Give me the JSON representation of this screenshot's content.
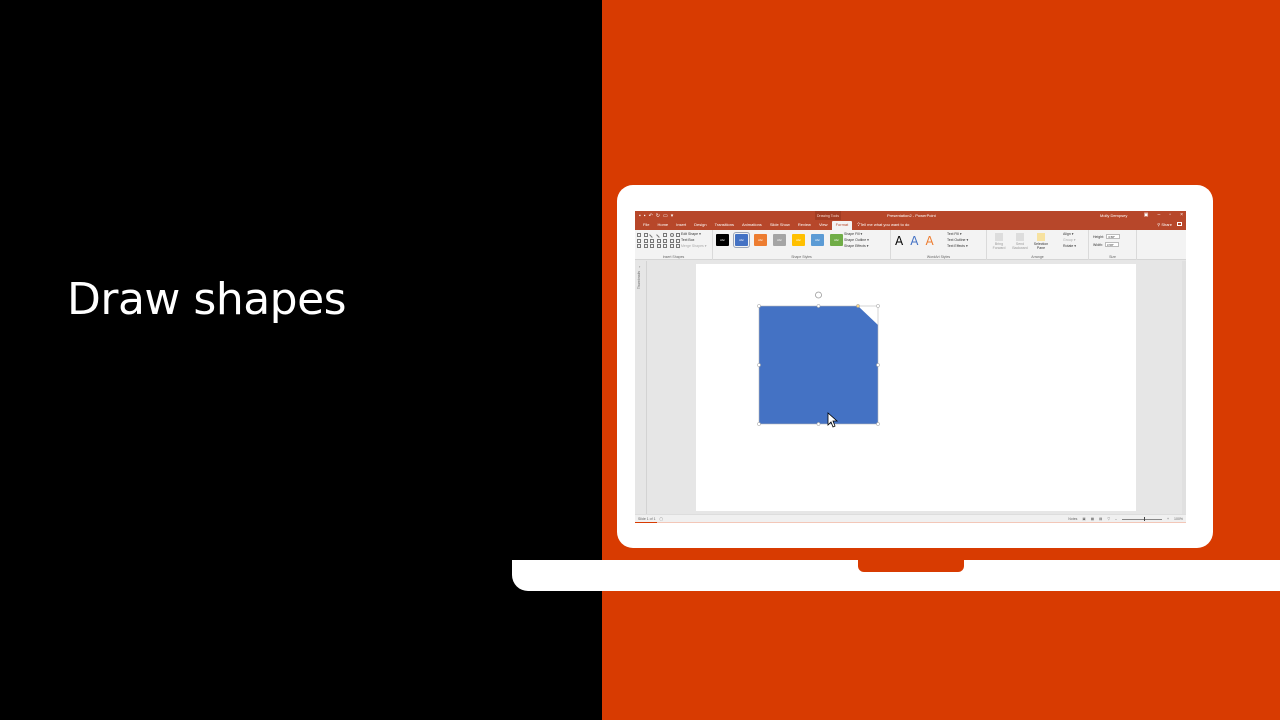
{
  "headline": "Draw shapes",
  "colors": {
    "brand_orange": "#d83b01",
    "ppt_red": "#b7472a",
    "shape_fill": "#4472c4",
    "background_left": "#000000"
  },
  "powerpoint": {
    "titlebar": {
      "quick_access": [
        "save-icon",
        "save-as-icon",
        "undo-icon",
        "redo-icon",
        "start-presentation-icon",
        "customize-icon"
      ],
      "context_label": "Drawing Tools",
      "doc_title": "Presentation2 - PowerPoint",
      "user": "Molly Dempsey",
      "window_controls": [
        "ribbon-display-icon",
        "minimize-icon",
        "restore-icon",
        "close-icon"
      ]
    },
    "tabs": [
      {
        "label": "File",
        "active": false
      },
      {
        "label": "Home",
        "active": false
      },
      {
        "label": "Insert",
        "active": false
      },
      {
        "label": "Design",
        "active": false
      },
      {
        "label": "Transitions",
        "active": false
      },
      {
        "label": "Animations",
        "active": false
      },
      {
        "label": "Slide Show",
        "active": false
      },
      {
        "label": "Review",
        "active": false
      },
      {
        "label": "View",
        "active": false
      },
      {
        "label": "Format",
        "active": true
      }
    ],
    "tell_me": "Tell me what you want to do",
    "share": "Share",
    "ribbon": {
      "insert_shapes": {
        "label": "Insert Shapes",
        "edit_shape": "Edit Shape ▾",
        "text_box": "Text Box",
        "merge_shapes": "Merge Shapes ▾"
      },
      "shape_styles": {
        "label": "Shape Styles",
        "chips": [
          {
            "text": "Abc",
            "color": "#000000"
          },
          {
            "text": "Abc",
            "color": "#4472c4"
          },
          {
            "text": "Abc",
            "color": "#ed7d31"
          },
          {
            "text": "Abc",
            "color": "#a5a5a5"
          },
          {
            "text": "Abc",
            "color": "#ffc000"
          },
          {
            "text": "Abc",
            "color": "#5b9bd5"
          },
          {
            "text": "Abc",
            "color": "#70ad47"
          }
        ],
        "selected_index": 1,
        "shape_fill": "Shape Fill ▾",
        "shape_outline": "Shape Outline ▾",
        "shape_effects": "Shape Effects ▾"
      },
      "wordart_styles": {
        "label": "WordArt Styles",
        "samples": [
          {
            "text": "A",
            "color": "#000000"
          },
          {
            "text": "A",
            "color": "#4472c4"
          },
          {
            "text": "A",
            "color": "#ed7d31"
          }
        ],
        "text_fill": "Text Fill ▾",
        "text_outline": "Text Outline ▾",
        "text_effects": "Text Effects ▾"
      },
      "arrange": {
        "label": "Arrange",
        "bring_forward": "Bring Forward",
        "send_backward": "Send Backward",
        "selection_pane": "Selection Pane",
        "align": "Align ▾",
        "group": "Group ▾",
        "rotate": "Rotate ▾"
      },
      "size": {
        "label": "Size",
        "height_label": "Height:",
        "height_value": "3.58\"",
        "width_label": "Width:",
        "width_value": "3.58\""
      }
    },
    "thumbnails_label": "Thumbnails",
    "status": {
      "slide_counter": "Slide 1 of 1",
      "notes": "Notes",
      "zoom": "100%",
      "zoom_fraction": 0.55,
      "progress_fraction": 0.04
    }
  }
}
